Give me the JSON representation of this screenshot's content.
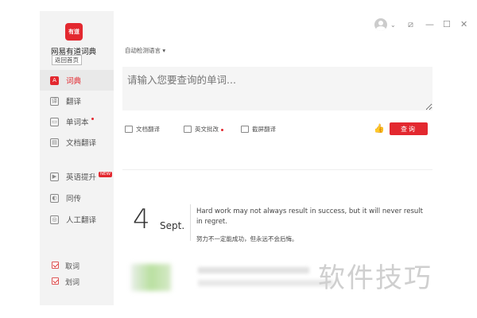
{
  "app": {
    "logo_text": "有道",
    "name": "网易有道词典",
    "back_home": "返回首页"
  },
  "sidebar": {
    "items": [
      {
        "label": "词典",
        "icon": "A"
      },
      {
        "label": "翻译",
        "icon": "译"
      },
      {
        "label": "单词本",
        "icon": "▭"
      },
      {
        "label": "文档翻译",
        "icon": "▤"
      },
      {
        "label": "英语提升",
        "icon": "▶",
        "badge": "NEW"
      },
      {
        "label": "同传",
        "icon": "◐"
      },
      {
        "label": "人工翻译",
        "icon": "◎"
      }
    ],
    "options": [
      {
        "label": "取词",
        "checked": true
      },
      {
        "label": "划词",
        "checked": true
      }
    ]
  },
  "header": {
    "lang_select": "自动检测语言 ▾",
    "avatar_arrow": "⌄",
    "controls": [
      "⧄",
      "—",
      "☐",
      "✕"
    ]
  },
  "search": {
    "placeholder": "请输入您要查询的单词..."
  },
  "toolbar": {
    "doc_translate": "文档翻译",
    "proofread": "英文批改",
    "screenshot_translate": "截屏翻译",
    "search_button": "查询"
  },
  "daily": {
    "day": "4",
    "month": "Sept.",
    "quote_en": "Hard work may not always result in success, but it will never result in regret.",
    "quote_zh": "努力不一定能成功，但永远不会后悔。"
  },
  "watermark": "软件技巧",
  "colors": {
    "accent": "#e3282f",
    "sidebar_bg": "#f3f3f3"
  }
}
